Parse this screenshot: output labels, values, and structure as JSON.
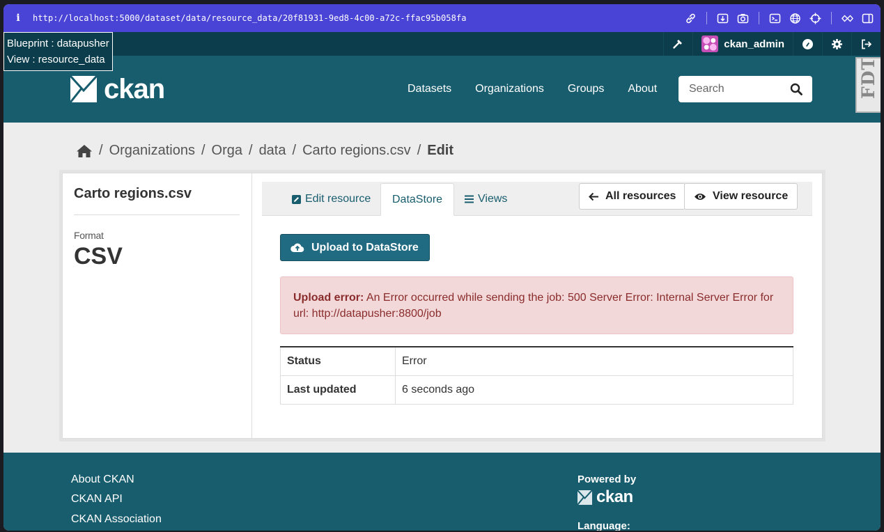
{
  "browser": {
    "info_glyph": "i",
    "url": "http://localhost:5000/dataset/data/resource_data/20f81931-9ed8-4c00-a72c-ffac95b058fa"
  },
  "debug": {
    "blueprint": "Blueprint : datapusher",
    "view": "View : resource_data"
  },
  "account": {
    "username": "ckan_admin"
  },
  "masthead": {
    "brand": "ckan",
    "nav": [
      "Datasets",
      "Organizations",
      "Groups",
      "About"
    ],
    "search_placeholder": "Search"
  },
  "debug_toolbar_label": "FDT",
  "breadcrumb": {
    "items": [
      "Organizations",
      "Orga",
      "data",
      "Carto regions.csv"
    ],
    "current": "Edit",
    "separator": "/"
  },
  "sidebar": {
    "title": "Carto regions.csv",
    "format_label": "Format",
    "format_value": "CSV"
  },
  "tabs": {
    "edit": "Edit resource",
    "datastore": "DataStore",
    "views": "Views"
  },
  "actions": {
    "all_resources": "All resources",
    "view_resource": "View resource"
  },
  "upload": {
    "label": "Upload to DataStore"
  },
  "alert": {
    "title": "Upload error:",
    "message": "An Error occurred while sending the job: 500 Server Error: Internal Server Error for url: http://datapusher:8800/job"
  },
  "status_table": [
    {
      "key": "Status",
      "value": "Error"
    },
    {
      "key": "Last updated",
      "value": "6 seconds ago"
    }
  ],
  "footer": {
    "links": [
      "About CKAN",
      "CKAN API",
      "CKAN Association"
    ],
    "powered_by": "Powered by",
    "brand": "ckan",
    "language_label": "Language:"
  },
  "colors": {
    "browser_bar": "#4a44d6",
    "account_bar": "#0b3d4c",
    "masthead": "#185d6e",
    "alert_bg": "#f3d8d9",
    "primary_button": "#206b82"
  }
}
